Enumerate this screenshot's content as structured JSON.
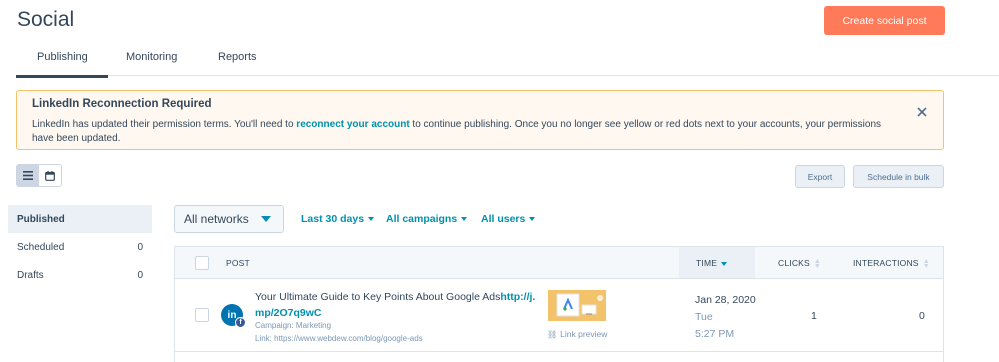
{
  "header": {
    "title": "Social",
    "create_button": "Create social post"
  },
  "tabs": [
    {
      "label": "Publishing",
      "active": true
    },
    {
      "label": "Monitoring",
      "active": false
    },
    {
      "label": "Reports",
      "active": false
    }
  ],
  "alert": {
    "title": "LinkedIn Reconnection Required",
    "body_before": "LinkedIn has updated their permission terms. You'll need to ",
    "link": "reconnect your account",
    "body_after": " to continue publishing. Once you no longer see yellow or red dots next to your accounts, your permissions have been updated."
  },
  "toolbar": {
    "export_label": "Export",
    "schedule_bulk_label": "Schedule in bulk"
  },
  "sidebar": {
    "items": [
      {
        "label": "Published",
        "count": "",
        "active": true
      },
      {
        "label": "Scheduled",
        "count": "0",
        "active": false
      },
      {
        "label": "Drafts",
        "count": "0",
        "active": false
      }
    ]
  },
  "filters": {
    "network": "All networks",
    "date_range": "Last 30 days",
    "campaigns": "All campaigns",
    "users": "All users"
  },
  "table": {
    "columns": {
      "post": "POST",
      "time": "TIME",
      "clicks": "CLICKS",
      "interactions": "INTERACTIONS"
    },
    "rows": [
      {
        "text_line1": "Your Ultimate Guide to Key Points About Google Ads",
        "url_part1": "http://j.",
        "url_part2": "mp/2O7q9wC",
        "campaign": "Campaign: Marketing",
        "link": "Link: https://www.webdew.com/blog/google-ads",
        "preview_label": "Link preview",
        "date": "Jan 28, 2020",
        "day": "Tue",
        "time": "5:27 PM",
        "clicks": "1",
        "interactions": "0"
      }
    ]
  },
  "colors": {
    "accent_orange": "#ff7a59",
    "link_teal": "#0091ae",
    "alert_border": "#f5c26b",
    "text": "#33475b"
  }
}
